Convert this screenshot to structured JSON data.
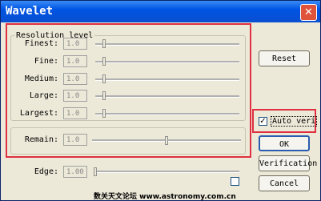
{
  "window": {
    "title": "Wavelet",
    "close_glyph": "✕"
  },
  "resolution": {
    "legend": "Resolution level",
    "rows": [
      {
        "label": "Finest:",
        "value": "1.0",
        "slider_fraction": 0.05
      },
      {
        "label": "Fine:",
        "value": "1.0",
        "slider_fraction": 0.05
      },
      {
        "label": "Medium:",
        "value": "1.0",
        "slider_fraction": 0.05
      },
      {
        "label": "Large:",
        "value": "1.0",
        "slider_fraction": 0.05
      },
      {
        "label": "Largest:",
        "value": "1.0",
        "slider_fraction": 0.05
      }
    ]
  },
  "remain": {
    "label": "Remain:",
    "value": "1.0",
    "slider_fraction": 0.5
  },
  "edge": {
    "label": "Edge:",
    "value": "1.00",
    "slider_fraction": 0.0
  },
  "buttons": {
    "reset": "Reset",
    "ok": "OK",
    "verification": "Verification",
    "cancel": "Cancel"
  },
  "auto_verify": {
    "label": "Auto veri",
    "checked": true,
    "check_glyph": "✓"
  },
  "footer": {
    "text": "数关天文论坛 www.astronomy.com.cn"
  },
  "colors": {
    "highlight": "#e03040",
    "title_bar": "#0054e3"
  }
}
